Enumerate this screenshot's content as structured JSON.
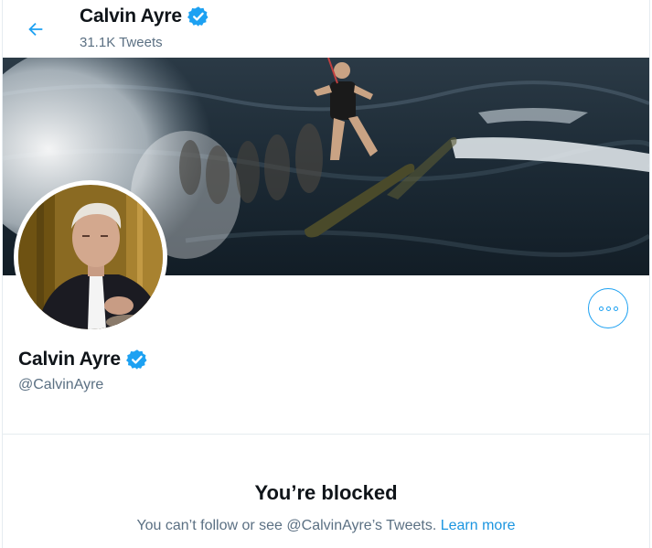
{
  "header": {
    "name": "Calvin Ayre",
    "tweet_count": "31.1K Tweets"
  },
  "profile": {
    "name": "Calvin Ayre",
    "handle": "@CalvinAyre",
    "verified": true
  },
  "blocked": {
    "title": "You’re blocked",
    "message": "You can’t follow or see @CalvinAyre’s Tweets.",
    "learn_more": "Learn more"
  },
  "icons": {
    "back": "back-arrow-icon",
    "verified": "verified-badge-icon",
    "more": "more-options-icon"
  },
  "colors": {
    "accent": "#1da1f2",
    "link": "#1b95e0",
    "secondary_text": "#5b7083",
    "divider": "#e6ecf0"
  }
}
